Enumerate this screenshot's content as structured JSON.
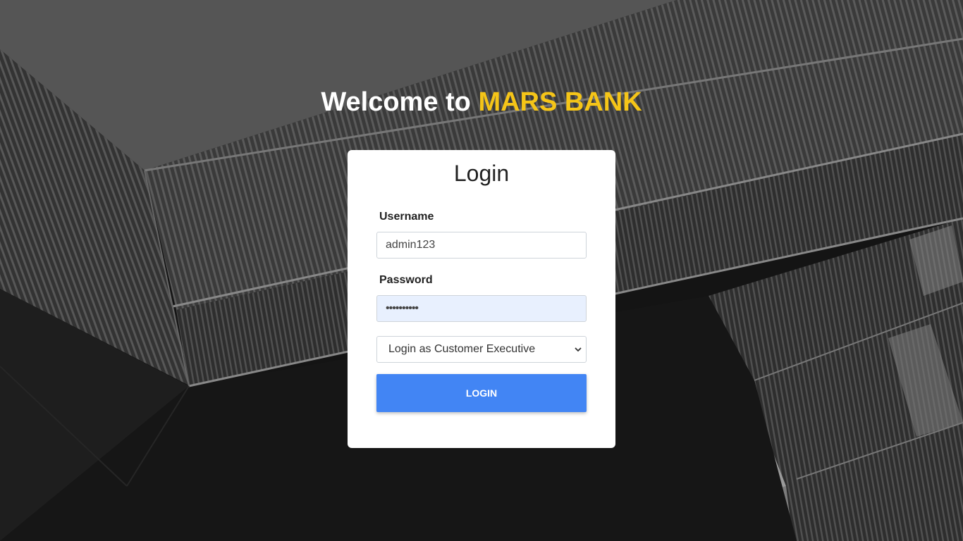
{
  "header": {
    "welcome_prefix": "Welcome to ",
    "brand_name": "MARS BANK"
  },
  "login_card": {
    "title": "Login",
    "username": {
      "label": "Username",
      "value": "admin123"
    },
    "password": {
      "label": "Password",
      "value": "••••••••••"
    },
    "role_select": {
      "selected": "Login as Customer Executive"
    },
    "submit_label": "LOGIN"
  },
  "colors": {
    "brand_accent": "#f5c518",
    "button": "#4285f4",
    "card_bg": "#ffffff",
    "autofill_bg": "#e8f0fe"
  },
  "icons": {
    "select_arrow": "chevron-down-icon"
  }
}
